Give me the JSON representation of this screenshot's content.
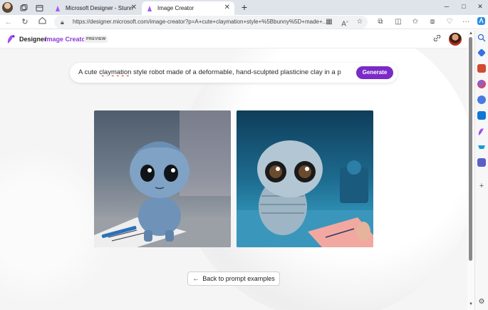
{
  "browser": {
    "tabs": [
      {
        "title": "Microsoft Designer - Stunning de",
        "active": false
      },
      {
        "title": "Image Creator",
        "active": true
      }
    ],
    "new_tab_label": "+",
    "url": "https://designer.microsoft.com/image-creator?p=A+cute+claymation+style+%5Bbunny%5D+made+...",
    "window_controls": {
      "minimize": "─",
      "maximize": "□",
      "close": "✕"
    }
  },
  "app": {
    "brand": "Designer",
    "product": "Image Creator",
    "badge": "PREVIEW"
  },
  "prompt": {
    "text_start": "A cute ",
    "text_misspelled": "claymation",
    "text_end": " style robot made of a deformable, hand-sculpted plasticine clay in a p",
    "generate_label": "Generate"
  },
  "results": [
    {
      "description": "claymation robot standing at desk with papers",
      "accent": "#7f9fc0"
    },
    {
      "description": "claymation robot with big eyes beside a hand writing",
      "accent": "#9ab8cf"
    }
  ],
  "back_button_label": "Back to prompt examples",
  "colors": {
    "brand_purple": "#7a2bc7",
    "product_text": "#8d3bd6",
    "background": "#f5f5f6"
  },
  "icons": {
    "sidebar": [
      "search-icon",
      "tag-icon",
      "toolbox-icon",
      "people-icon",
      "copilot-icon",
      "outlook-icon",
      "designer-icon",
      "shopping-icon",
      "teams-icon"
    ]
  }
}
